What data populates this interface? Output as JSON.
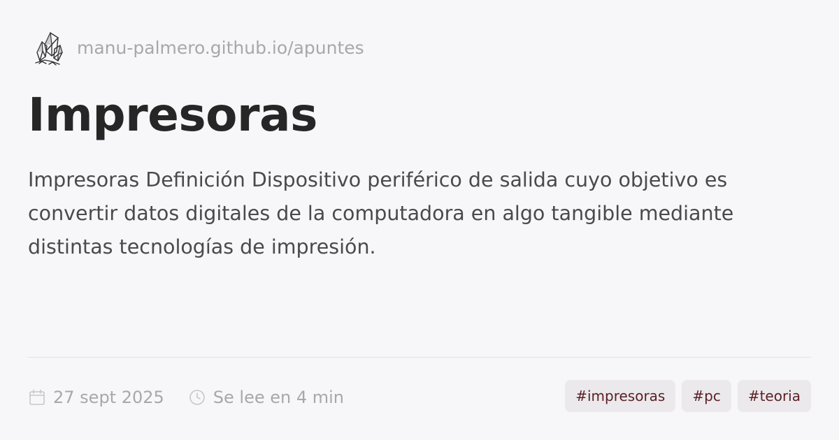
{
  "site": {
    "logo_icon": "crystal-logo-icon",
    "url": "manu-palmero.github.io/apuntes"
  },
  "article": {
    "title": "Impresoras",
    "description": "Impresoras Definición Dispositivo periférico de salida cuyo objetivo es convertir datos digitales de la computadora en algo tangible mediante distintas tecnologías de impresión."
  },
  "meta": {
    "date_icon": "calendar-icon",
    "date": "27 sept 2025",
    "reading_icon": "clock-icon",
    "reading_time": "Se lee en 4 min"
  },
  "tags": [
    "#impresoras",
    "#pc",
    "#teoria"
  ],
  "colors": {
    "background": "#f7f6f8",
    "title": "#262626",
    "muted": "#a9a7ab",
    "tag_background": "#ebe9ec",
    "tag_text": "#5a1f24"
  }
}
